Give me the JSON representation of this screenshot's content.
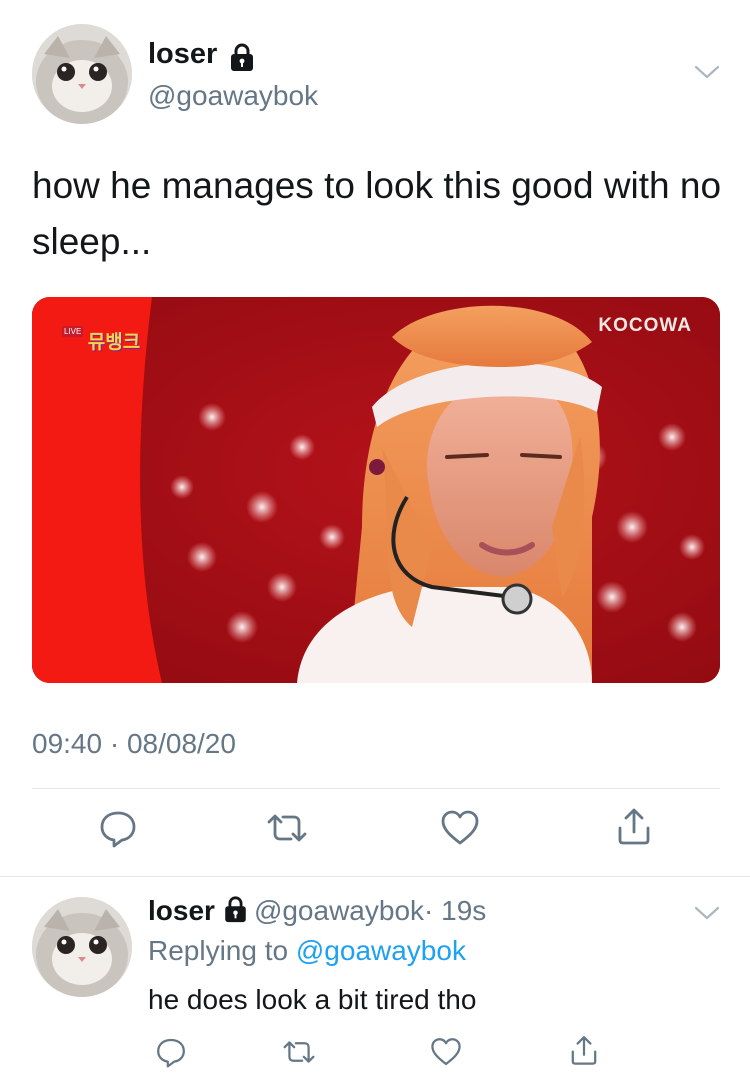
{
  "tweet": {
    "author_name": "loser",
    "author_handle": "@goawaybok",
    "text": "how he manages to look this good with no sleep...",
    "media": {
      "watermark": "KOCOWA",
      "show_logo_live": "LIVE",
      "show_logo_text": "뮤뱅크"
    },
    "timestamp": "09:40 · 08/08/20",
    "icons": {
      "lock": "lock-icon",
      "menu": "chevron-down-icon",
      "reply": "comment-icon",
      "retweet": "retweet-icon",
      "like": "heart-icon",
      "share": "share-icon"
    }
  },
  "reply": {
    "author_name": "loser",
    "author_handle": "@goawaybok",
    "time_ago": "· 19s",
    "replying_prefix": "Replying to ",
    "replying_handle": "@goawaybok",
    "text": "he does look a bit tired tho"
  },
  "colors": {
    "text_primary": "#14171a",
    "text_secondary": "#657786",
    "link": "#1da1f2",
    "divider": "#e1e8ed"
  }
}
